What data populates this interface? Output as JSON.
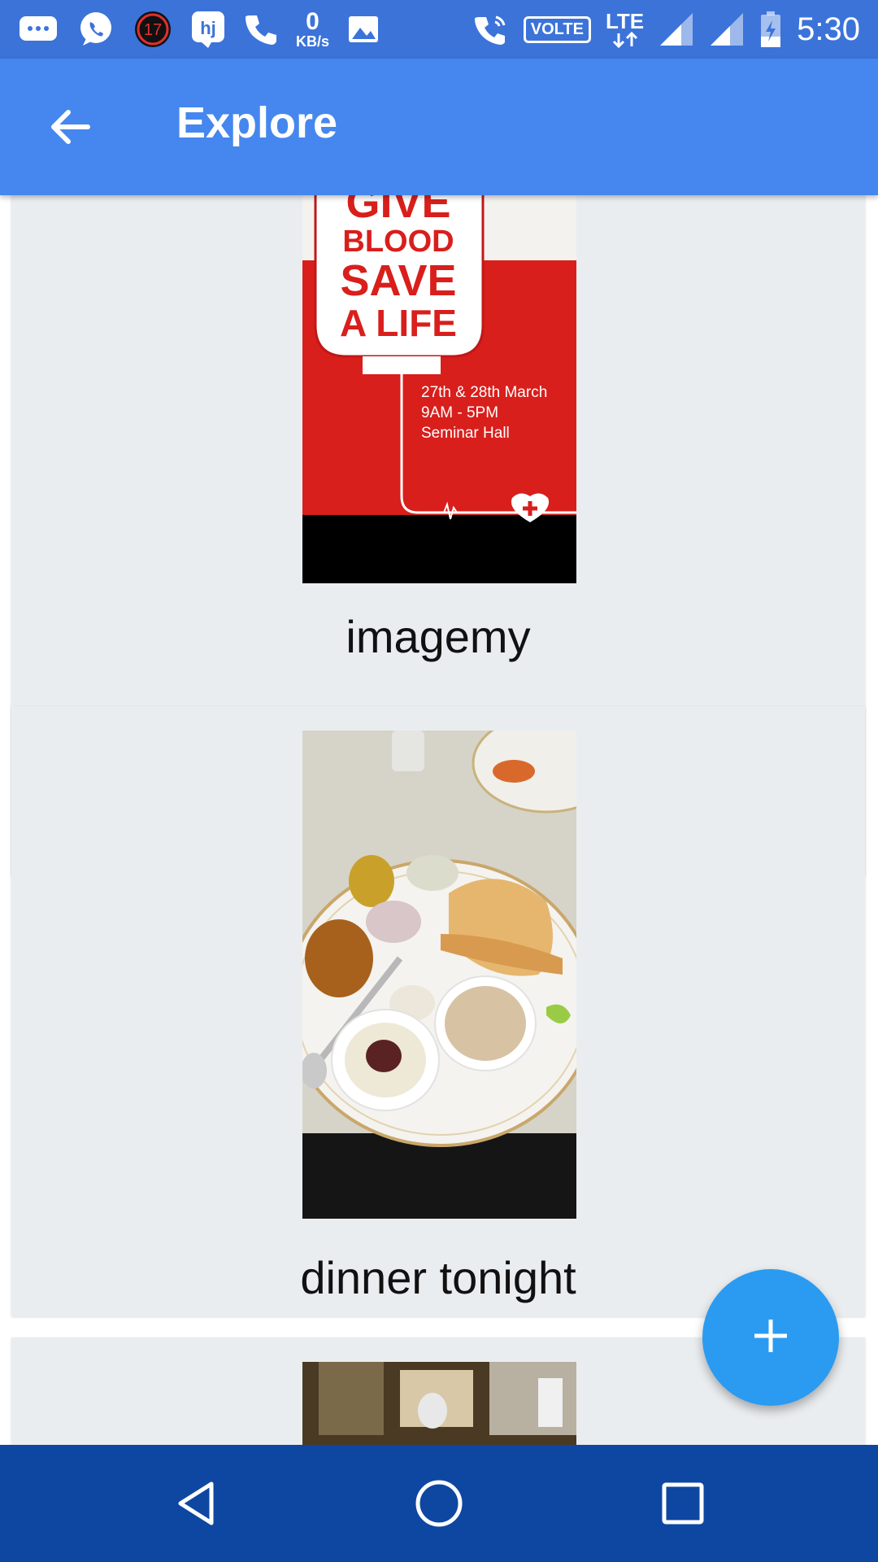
{
  "status_bar": {
    "time": "5:30",
    "notification_badge": "17",
    "hj_label": "hj",
    "speed_value": "0",
    "speed_unit": "KB/s",
    "volte": "VOLTE",
    "lte": "LTE",
    "color": "#3b73d9"
  },
  "app_bar": {
    "title": "Explore",
    "color": "#4587ee"
  },
  "posts": [
    {
      "caption": "imagemy",
      "poster": {
        "line1": "GIVE",
        "line2": "BLOOD",
        "line3": "SAVE",
        "line4": "A LIFE",
        "date": "27th & 28th March",
        "time": "9AM - 5PM",
        "venue": "Seminar Hall"
      }
    },
    {
      "caption": "dinner tonight"
    }
  ],
  "fab": {
    "icon": "plus-icon",
    "color": "#2a9bf0"
  },
  "nav_bar": {
    "color": "#0e47a1",
    "buttons": [
      "back-icon",
      "home-icon",
      "recents-icon"
    ]
  }
}
